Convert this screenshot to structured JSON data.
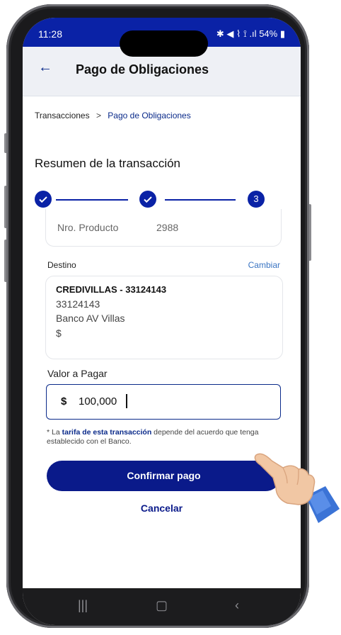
{
  "status": {
    "time": "11:28",
    "time_extra": "⋮⋮",
    "icons_text": "✱ ◀ ⌇ ⟟ .ıl",
    "battery": "54%"
  },
  "header": {
    "back_icon": "back-arrow-icon",
    "title": "Pago de Obligaciones"
  },
  "breadcrumb": {
    "root": "Transacciones",
    "separator": ">",
    "current": "Pago de Obligaciones"
  },
  "section": {
    "title": "Resumen de la transacción"
  },
  "stepper": {
    "steps": [
      {
        "state": "done",
        "label": ""
      },
      {
        "state": "done",
        "label": ""
      },
      {
        "state": "current",
        "label": "3"
      }
    ]
  },
  "product": {
    "label": "Nro. Producto",
    "value": "2988"
  },
  "destino": {
    "label": "Destino",
    "change_label": "Cambiar",
    "name": "CREDIVILLAS - 33124143",
    "number": "33124143",
    "bank": "Banco AV Villas",
    "currency": "$"
  },
  "valor": {
    "label": "Valor a Pagar",
    "currency": "$",
    "amount": "100,000"
  },
  "note": {
    "prefix": "* La ",
    "link": "tarifa de esta transacción",
    "suffix": " depende del acuerdo que tenga establecido con el Banco."
  },
  "actions": {
    "confirm_label": "Confirmar pago",
    "cancel_label": "Cancelar"
  },
  "colors": {
    "primary": "#0a1a8a",
    "status_bar": "#0a22a6",
    "link": "#3a74c2"
  }
}
